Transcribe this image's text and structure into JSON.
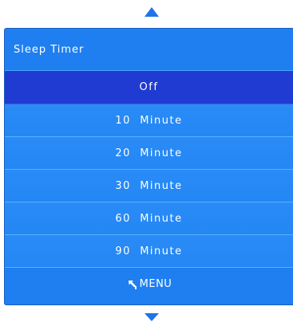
{
  "menu": {
    "title": "Sleep Timer",
    "items": [
      {
        "label": "Off",
        "selected": true
      },
      {
        "label": "10  Minute",
        "selected": false
      },
      {
        "label": "20  Minute",
        "selected": false
      },
      {
        "label": "30  Minute",
        "selected": false
      },
      {
        "label": "60  Minute",
        "selected": false
      },
      {
        "label": "90  Minute",
        "selected": false
      }
    ],
    "footer_label": "MENU",
    "footer_icon": "back-arrow-icon"
  },
  "colors": {
    "panel": "#1f7ff0",
    "selected": "#1f3bd1",
    "arrow": "#1f74e8",
    "text": "#ffffff"
  }
}
